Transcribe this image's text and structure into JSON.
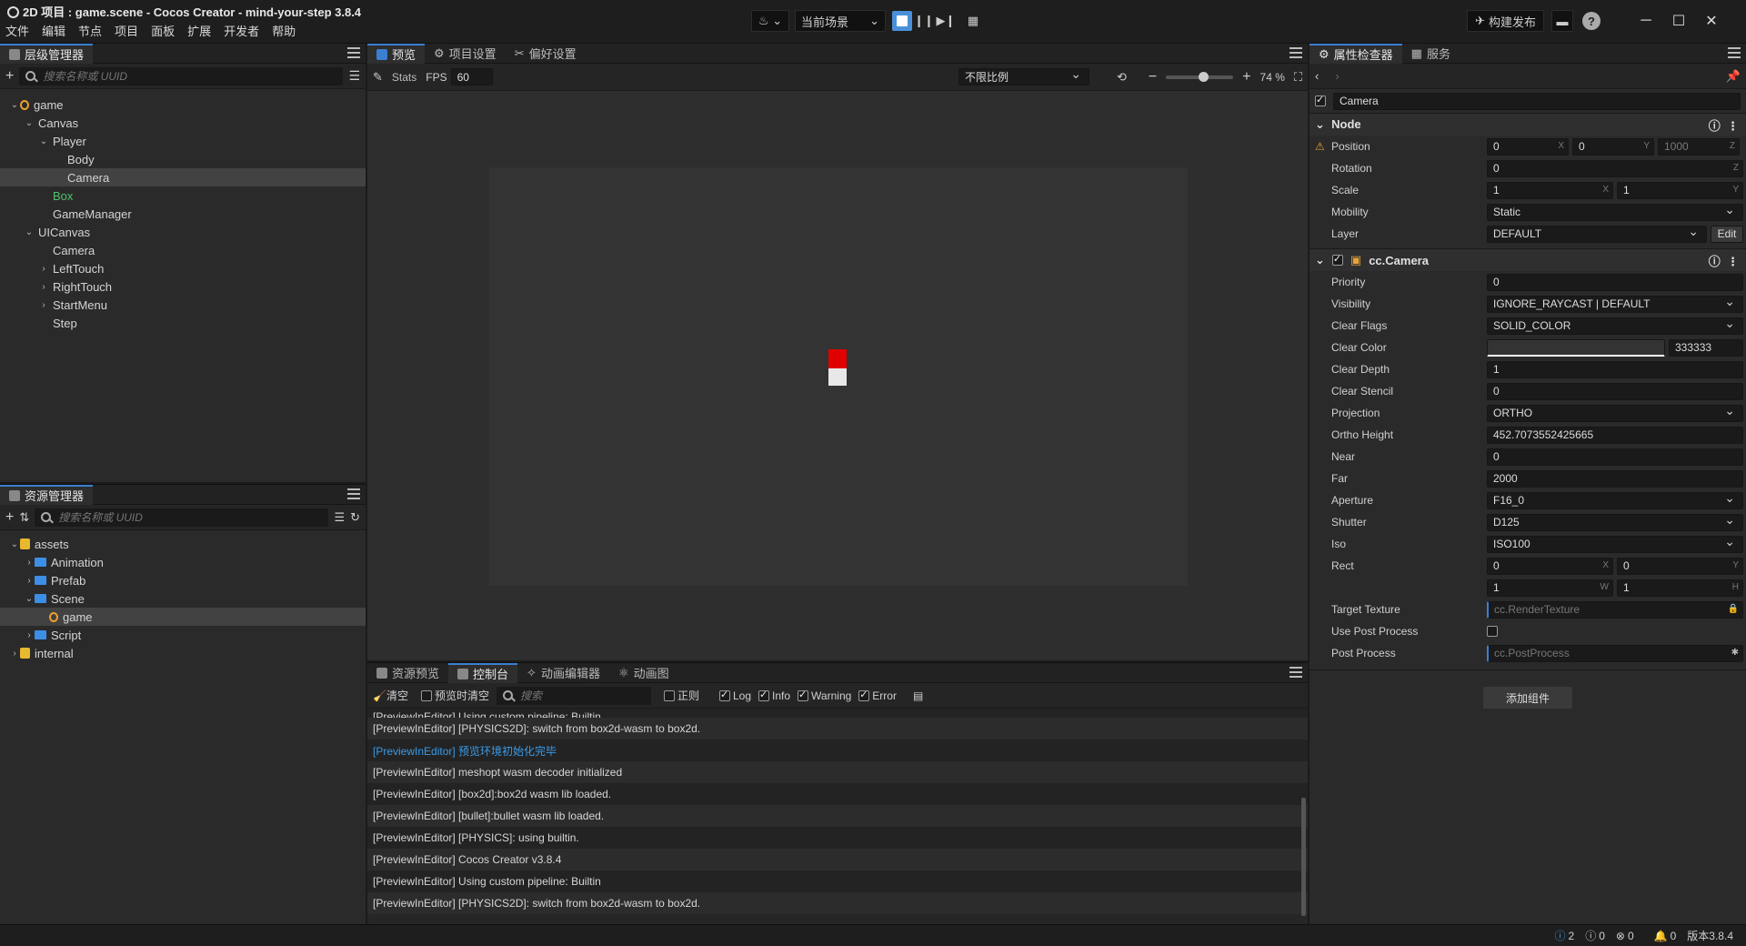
{
  "window": {
    "title": "2D 项目 : game.scene - Cocos Creator - mind-your-step 3.8.4",
    "menu": [
      "文件",
      "编辑",
      "节点",
      "项目",
      "面板",
      "扩展",
      "开发者",
      "帮助"
    ],
    "scene_select": "当前场景",
    "build_publish": "构建发布"
  },
  "hierarchy": {
    "tab": "层级管理器",
    "search_placeholder": "搜索名称或 UUID",
    "nodes": [
      {
        "label": "game",
        "depth": 0,
        "arrow": "⌄",
        "icon": "scene"
      },
      {
        "label": "Canvas",
        "depth": 1,
        "arrow": "⌄"
      },
      {
        "label": "Player",
        "depth": 2,
        "arrow": "⌄"
      },
      {
        "label": "Body",
        "depth": 3,
        "arrow": ""
      },
      {
        "label": "Camera",
        "depth": 3,
        "arrow": "",
        "selected": true
      },
      {
        "label": "Box",
        "depth": 2,
        "arrow": "",
        "color": "#4fc36a"
      },
      {
        "label": "GameManager",
        "depth": 2,
        "arrow": ""
      },
      {
        "label": "UICanvas",
        "depth": 1,
        "arrow": "⌄"
      },
      {
        "label": "Camera",
        "depth": 2,
        "arrow": ""
      },
      {
        "label": "LeftTouch",
        "depth": 2,
        "arrow": "›"
      },
      {
        "label": "RightTouch",
        "depth": 2,
        "arrow": "›"
      },
      {
        "label": "StartMenu",
        "depth": 2,
        "arrow": "›"
      },
      {
        "label": "Step",
        "depth": 2,
        "arrow": ""
      }
    ]
  },
  "assets": {
    "tab": "资源管理器",
    "search_placeholder": "搜索名称或 UUID",
    "nodes": [
      {
        "label": "assets",
        "depth": 0,
        "arrow": "⌄",
        "icon": "db"
      },
      {
        "label": "Animation",
        "depth": 1,
        "arrow": "›",
        "icon": "folder"
      },
      {
        "label": "Prefab",
        "depth": 1,
        "arrow": "›",
        "icon": "folder"
      },
      {
        "label": "Scene",
        "depth": 1,
        "arrow": "⌄",
        "icon": "folder"
      },
      {
        "label": "game",
        "depth": 2,
        "arrow": "",
        "icon": "scene",
        "selected": true
      },
      {
        "label": "Script",
        "depth": 1,
        "arrow": "›",
        "icon": "folder"
      },
      {
        "label": "internal",
        "depth": 0,
        "arrow": "›",
        "icon": "db"
      }
    ]
  },
  "preview": {
    "tabs": [
      "预览",
      "项目设置",
      "偏好设置"
    ],
    "stats": "Stats",
    "fps_label": "FPS",
    "fps_value": "60",
    "ratio": "不限比例",
    "zoom": "74 %",
    "zoom_level": 0.55
  },
  "console": {
    "tabs": [
      "资源预览",
      "控制台",
      "动画编辑器",
      "动画图"
    ],
    "clear": "清空",
    "clear_on_preview": "预览时清空",
    "search_placeholder": "搜索",
    "regex": "正则",
    "filters": [
      "Log",
      "Info",
      "Warning",
      "Error"
    ],
    "partial_line": "[PreviewInEditor] Using custom pipeline: Builtin",
    "lines": [
      {
        "text": "[PreviewInEditor] [PHYSICS2D]: switch from box2d-wasm to box2d.",
        "info": false
      },
      {
        "text": "[PreviewInEditor] 预览环境初始化完毕",
        "info": true
      },
      {
        "text": "[PreviewInEditor] meshopt wasm decoder initialized",
        "info": false
      },
      {
        "text": "[PreviewInEditor] [box2d]:box2d wasm lib loaded.",
        "info": false
      },
      {
        "text": "[PreviewInEditor] [bullet]:bullet wasm lib loaded.",
        "info": false
      },
      {
        "text": "[PreviewInEditor] [PHYSICS]: using builtin.",
        "info": false
      },
      {
        "text": "[PreviewInEditor] Cocos Creator v3.8.4",
        "info": false
      },
      {
        "text": "[PreviewInEditor] Using custom pipeline: Builtin",
        "info": false
      },
      {
        "text": "[PreviewInEditor] [PHYSICS2D]: switch from box2d-wasm to box2d.",
        "info": false
      }
    ]
  },
  "inspector": {
    "tabs": [
      "属性检查器",
      "服务"
    ],
    "node_name": "Camera",
    "node_section": "Node",
    "position": {
      "label": "Position",
      "x": "0",
      "y": "0",
      "z": "1000"
    },
    "rotation": {
      "label": "Rotation",
      "z": "0"
    },
    "scale": {
      "label": "Scale",
      "x": "1",
      "y": "1"
    },
    "mobility": {
      "label": "Mobility",
      "value": "Static"
    },
    "layer": {
      "label": "Layer",
      "value": "DEFAULT",
      "edit": "Edit"
    },
    "camera_section": "cc.Camera",
    "props": [
      {
        "label": "Priority",
        "value": "0",
        "select": false
      },
      {
        "label": "Visibility",
        "value": "IGNORE_RAYCAST | DEFAULT",
        "select": true
      },
      {
        "label": "Clear Flags",
        "value": "SOLID_COLOR",
        "select": true
      }
    ],
    "clear_color": {
      "label": "Clear Color",
      "hex": "333333"
    },
    "props2": [
      {
        "label": "Clear Depth",
        "value": "1",
        "select": false
      },
      {
        "label": "Clear Stencil",
        "value": "0",
        "select": false
      },
      {
        "label": "Projection",
        "value": "ORTHO",
        "select": true
      },
      {
        "label": "Ortho Height",
        "value": "452.7073552425665",
        "select": false
      },
      {
        "label": "Near",
        "value": "0",
        "select": false
      },
      {
        "label": "Far",
        "value": "2000",
        "select": false
      },
      {
        "label": "Aperture",
        "value": "F16_0",
        "select": true
      },
      {
        "label": "Shutter",
        "value": "D125",
        "select": true
      },
      {
        "label": "Iso",
        "value": "ISO100",
        "select": true
      }
    ],
    "rect": {
      "label": "Rect",
      "x": "0",
      "y": "0",
      "w": "1",
      "h": "1"
    },
    "target_texture": {
      "label": "Target Texture",
      "value": "cc.RenderTexture"
    },
    "use_post_process": {
      "label": "Use Post Process"
    },
    "post_process": {
      "label": "Post Process",
      "value": "cc.PostProcess"
    },
    "add_component": "添加组件"
  },
  "status": {
    "info_count": "2",
    "warn_count": "0",
    "error_count": "0",
    "notify_count": "0",
    "version": "版本3.8.4"
  },
  "colors": {
    "accent": "#3b7fd1",
    "box_node": "#4fc36a",
    "log_info": "#3a9be8",
    "player_red": "#e00000",
    "player_white": "#e8e8e8"
  }
}
